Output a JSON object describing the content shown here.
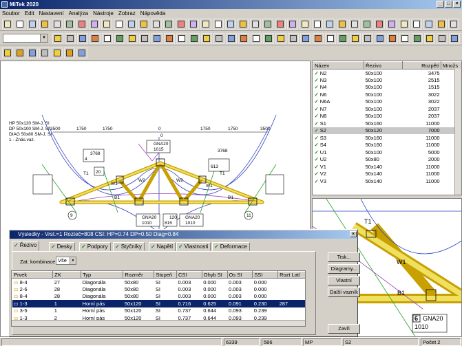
{
  "app": {
    "title": "MiTek 2020",
    "accent": "#0a246a"
  },
  "menu": [
    "Soubor",
    "Edit",
    "Nastavení",
    "Analýza",
    "Nástroje",
    "Zobraz",
    "Nápověda"
  ],
  "members": {
    "columns": [
      "Název",
      "Řezivo",
      "Rozpětí",
      "Množs"
    ],
    "rows": [
      [
        "N2",
        "50x100",
        "3475"
      ],
      [
        "N3",
        "50x100",
        "2515"
      ],
      [
        "N4",
        "50x100",
        "1515"
      ],
      [
        "N6",
        "50x100",
        "3022"
      ],
      [
        "N6A",
        "50x100",
        "3022"
      ],
      [
        "N7",
        "50x100",
        "2037"
      ],
      [
        "N8",
        "50x100",
        "2037"
      ],
      [
        "S1",
        "50x160",
        "11000"
      ],
      [
        "S2",
        "50x120",
        "7000"
      ],
      [
        "S3",
        "50x160",
        "11000"
      ],
      [
        "S4",
        "50x160",
        "11000"
      ],
      [
        "U1",
        "50x100",
        "5000"
      ],
      [
        "U2",
        "50x80",
        "2000"
      ],
      [
        "V1",
        "50x140",
        "11000"
      ],
      [
        "V2",
        "50x140",
        "11000"
      ],
      [
        "V3",
        "50x140",
        "11000"
      ]
    ]
  },
  "canvas": {
    "legend": [
      "HP 50x120 SM-J, SI",
      "DP 50x100 SM-J, SI",
      "DIAG 50x80 SM-J, SI",
      "1 - Znás.vaz."
    ],
    "dims": [
      "3500",
      "1750",
      "1750",
      "0",
      "1750",
      "1750",
      "3500"
    ],
    "plates": [
      "GNA20",
      "1015",
      "GNA20",
      "1010",
      "815",
      "GNA20",
      "1010"
    ],
    "labels": [
      "3768",
      "3768",
      "0",
      "20",
      "W2",
      "W2",
      "W1",
      "W1",
      "B1",
      "B1",
      "T1",
      "T1",
      "120",
      "4",
      "613",
      "9",
      "11"
    ]
  },
  "detail": {
    "labels": [
      "T1",
      "W1",
      "B1"
    ],
    "plate_num": "6",
    "plate_name": "GNA20",
    "plate_size": "1010"
  },
  "dialog": {
    "title": "Výsledky - Vrst.=1 Rozteč=808 CSI: HP=0.74 DP=0.50 Diag=0.84",
    "tabs": [
      "Řezivo",
      "Desky",
      "Podpory",
      "Styčníky",
      "Napětí",
      "Vlastnosti",
      "Deformace"
    ],
    "combo_label": "Zat. kombinace",
    "combo_value": "Vše",
    "columns": [
      "Prvek",
      "ZK",
      "Typ",
      "Rozměr",
      "Stupeň",
      "CSI",
      "Ohyb SI",
      "Os SI",
      "SSI",
      "Rozt Lat/"
    ],
    "rows": [
      [
        "8-4",
        "27",
        "Diagonála",
        "50x80",
        "SI",
        "0.003",
        "0.000",
        "0.003",
        "0.000",
        ""
      ],
      [
        "2-6",
        "28",
        "Diagonála",
        "50x80",
        "SI",
        "0.003",
        "0.000",
        "0.003",
        "0.000",
        ""
      ],
      [
        "8-4",
        "28",
        "Diagonála",
        "50x80",
        "SI",
        "0.003",
        "0.000",
        "0.003",
        "0.000",
        ""
      ],
      [
        "1-3",
        "1",
        "Horní pás",
        "50x120",
        "SI",
        "0.716",
        "0.625",
        "0.091",
        "0.230",
        "287"
      ],
      [
        "3-5",
        "1",
        "Horní pás",
        "50x120",
        "SI",
        "0.737",
        "0.644",
        "0.093",
        "0.239",
        ""
      ],
      [
        "1-3",
        "2",
        "Horní pás",
        "50x120",
        "SI",
        "0.737",
        "0.644",
        "0.093",
        "0.239",
        ""
      ]
    ],
    "buttons": [
      "Tisk...",
      "Diagramy...",
      "Vlastní",
      "Další vazník",
      "Zavři"
    ]
  },
  "status": [
    "6339",
    "586",
    "MP",
    "S2",
    "Počet 2"
  ]
}
